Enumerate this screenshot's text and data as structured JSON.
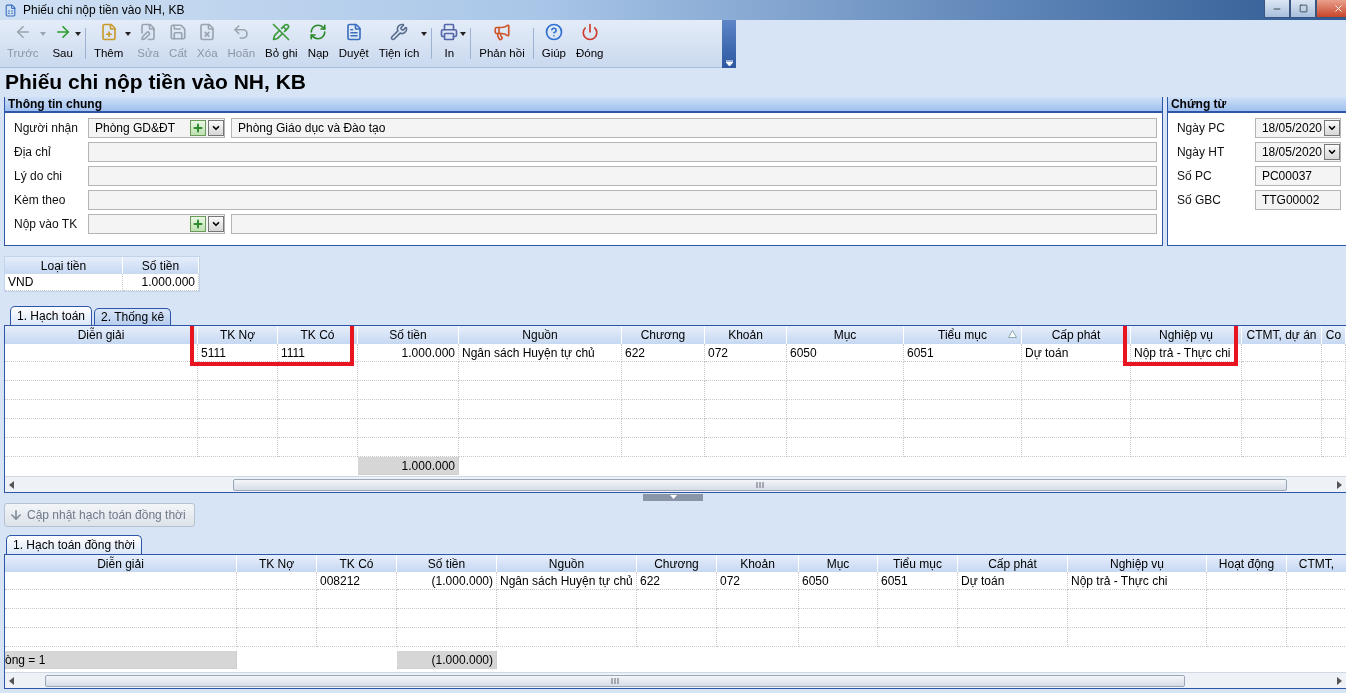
{
  "window": {
    "title": "Phiếu chi nộp tiền vào NH, KB"
  },
  "toolbar": {
    "groups": [
      [
        {
          "label": "Trước",
          "disabled": true,
          "dropdown": true
        },
        {
          "label": "Sau",
          "disabled": false,
          "dropdown": true
        }
      ],
      [
        {
          "label": "Thêm",
          "disabled": false,
          "dropdown": true
        },
        {
          "label": "Sửa",
          "disabled": true,
          "dropdown": false
        },
        {
          "label": "Cất",
          "disabled": true,
          "dropdown": false
        },
        {
          "label": "Xóa",
          "disabled": true,
          "dropdown": false
        },
        {
          "label": "Hoãn",
          "disabled": true,
          "dropdown": false
        },
        {
          "label": "Bỏ ghi",
          "disabled": false,
          "dropdown": false
        },
        {
          "label": "Nạp",
          "disabled": false,
          "dropdown": false
        },
        {
          "label": "Duyệt",
          "disabled": false,
          "dropdown": false
        },
        {
          "label": "Tiện ích",
          "disabled": false,
          "dropdown": true
        }
      ],
      [
        {
          "label": "In",
          "disabled": false,
          "dropdown": true
        }
      ],
      [
        {
          "label": "Phản hồi",
          "disabled": false,
          "dropdown": false
        }
      ],
      [
        {
          "label": "Giúp",
          "disabled": false,
          "dropdown": false
        },
        {
          "label": "Đóng",
          "disabled": false,
          "dropdown": false
        }
      ]
    ]
  },
  "heading": "Phiếu chi nộp tiền vào NH, KB",
  "general_info": {
    "title": "Thông tin chung",
    "fields": [
      {
        "kind": "combo",
        "label": "Người nhận",
        "code": "Phòng GD&ĐT",
        "value": "Phòng Giáo dục và Đào tạo"
      },
      {
        "kind": "text",
        "label": "Địa chỉ"
      },
      {
        "kind": "text",
        "label": "Lý do chi"
      },
      {
        "kind": "text",
        "label": "Kèm theo"
      },
      {
        "kind": "combo",
        "label": "Nộp vào TK"
      }
    ]
  },
  "voucher": {
    "title": "Chứng từ",
    "fields": [
      {
        "kind": "date",
        "label": "Ngày PC",
        "value": "18/05/2020"
      },
      {
        "kind": "date",
        "label": "Ngày HT",
        "value": "18/05/2020"
      },
      {
        "kind": "text",
        "label": "Số PC",
        "value": "PC00037"
      },
      {
        "kind": "text",
        "label": "Số GBC",
        "value": "TTG00002"
      }
    ]
  },
  "currency_table": {
    "columns": [
      "Loại tiền",
      "Số tiền"
    ],
    "rows": [
      [
        "VND",
        "1.000.000"
      ]
    ]
  },
  "tabs": [
    {
      "label": "1. Hạch toán",
      "selected": true
    },
    {
      "label": "2. Thống kê",
      "selected": false
    }
  ],
  "entries_grid": {
    "columns": [
      {
        "label": "Diễn giải",
        "highlighted": false,
        "sorted": false
      },
      {
        "label": "TK Nợ",
        "highlighted": true,
        "sorted": false
      },
      {
        "label": "TK Có",
        "highlighted": true,
        "sorted": false
      },
      {
        "label": "Số tiền",
        "highlighted": false,
        "sorted": false
      },
      {
        "label": "Nguồn",
        "highlighted": false,
        "sorted": false
      },
      {
        "label": "Chương",
        "highlighted": false,
        "sorted": false
      },
      {
        "label": "Khoản",
        "highlighted": false,
        "sorted": false
      },
      {
        "label": "Mục",
        "highlighted": false,
        "sorted": false
      },
      {
        "label": "Tiểu mục",
        "highlighted": false,
        "sorted": true
      },
      {
        "label": "Cấp phát",
        "highlighted": false,
        "sorted": false
      },
      {
        "label": "Nghiệp vụ",
        "highlighted": true,
        "sorted": false
      },
      {
        "label": "CTMT, dự án",
        "highlighted": false,
        "sorted": false
      },
      {
        "label": "Co",
        "highlighted": false,
        "sorted": false
      }
    ],
    "rows": [
      [
        null,
        "5111",
        "1111",
        "1.000.000",
        "Ngân sách Huyện tự chủ",
        "622",
        "072",
        "6050",
        "6051",
        "Dự toán",
        "Nộp trả - Thực chi",
        null,
        null
      ]
    ],
    "total": "1.000.000"
  },
  "update_button": {
    "label": "Cập nhật hạch toán đồng thời",
    "disabled": true
  },
  "sub_tabs": [
    {
      "label": "1. Hạch toán đồng thời",
      "selected": true
    }
  ],
  "sync_grid": {
    "columns": [
      "Diễn giải",
      "TK Nợ",
      "TK Có",
      "Số tiền",
      "Nguồn",
      "Chương",
      "Khoản",
      "Mục",
      "Tiểu mục",
      "Cấp phát",
      "Nghiệp vụ",
      "Hoạt động",
      "CTMT,"
    ],
    "rows": [
      [
        null,
        null,
        "008212",
        "(1.000.000)",
        "Ngân sách Huyện tự chủ",
        "622",
        "072",
        "6050",
        "6051",
        "Dự toán",
        "Nộp trả - Thực chi",
        null,
        null
      ]
    ],
    "count": "òng = 1",
    "total": "(1.000.000)"
  }
}
